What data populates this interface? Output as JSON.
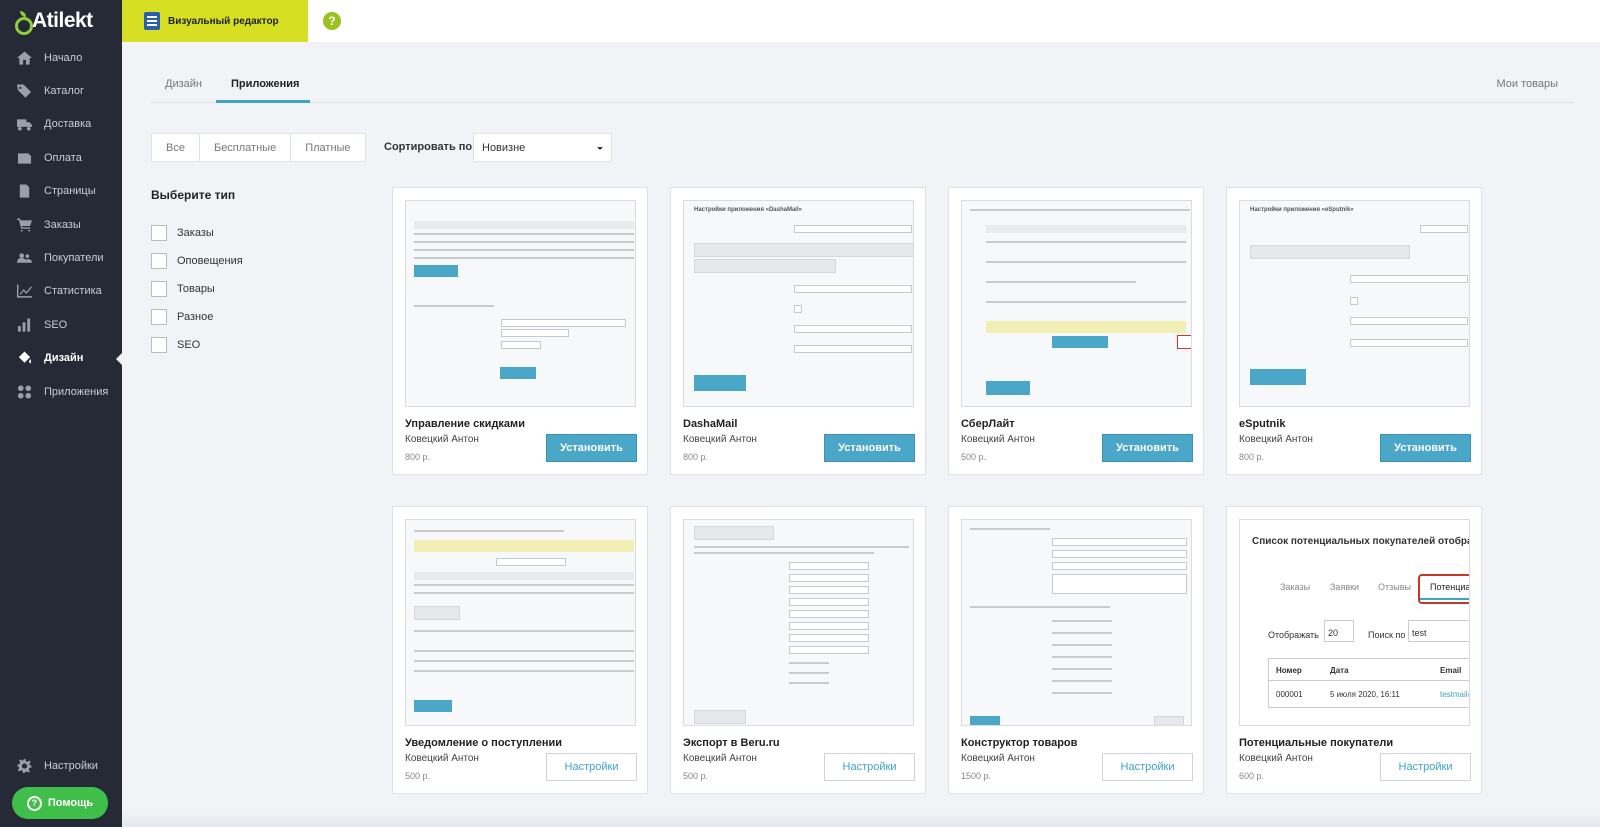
{
  "brand": {
    "name": "Atilekt",
    "accent": "#8fcf3c"
  },
  "sidebar": {
    "items": [
      {
        "label": "Начало",
        "icon": "home-icon"
      },
      {
        "label": "Каталог",
        "icon": "tag-icon"
      },
      {
        "label": "Доставка",
        "icon": "truck-icon"
      },
      {
        "label": "Оплата",
        "icon": "wallet-icon"
      },
      {
        "label": "Страницы",
        "icon": "page-icon"
      },
      {
        "label": "Заказы",
        "icon": "cart-icon"
      },
      {
        "label": "Покупатели",
        "icon": "users-icon"
      },
      {
        "label": "Статистика",
        "icon": "chart-line-icon"
      },
      {
        "label": "SEO",
        "icon": "bars-icon"
      },
      {
        "label": "Дизайн",
        "icon": "paint-icon"
      },
      {
        "label": "Приложения",
        "icon": "apps-icon"
      }
    ],
    "active": "Дизайн",
    "settings_label": "Настройки",
    "help_label": "Помощь"
  },
  "topbar": {
    "visual_editor_label": "Визуальный редактор",
    "help_symbol": "?"
  },
  "tabs": {
    "design": "Дизайн",
    "apps": "Приложения",
    "my_goods": "Мои товары"
  },
  "filters": {
    "price": [
      "Все",
      "Бесплатные",
      "Платные"
    ],
    "sort_label": "Сортировать по",
    "sort_value": "Новизне"
  },
  "types": {
    "title": "Выберите тип",
    "items": [
      "Заказы",
      "Оповещения",
      "Товары",
      "Разное",
      "SEO"
    ]
  },
  "apps": [
    {
      "title": "Управление скидками",
      "author": "Ковецкий Антон",
      "price": "800 р.",
      "action": "Установить"
    },
    {
      "title": "DashaMail",
      "author": "Ковецкий Антон",
      "price": "800 р.",
      "action": "Установить"
    },
    {
      "title": "СберЛайт",
      "author": "Ковецкий Антон",
      "price": "500 р.",
      "action": "Установить"
    },
    {
      "title": "eSputnik",
      "author": "Ковецкий Антон",
      "price": "800 р.",
      "action": "Установить"
    },
    {
      "title": "Уведомление о поступлении",
      "author": "Ковецкий Антон",
      "price": "500 р.",
      "action": "Настройки"
    },
    {
      "title": "Экспорт в Beru.ru",
      "author": "Ковецкий Антон",
      "price": "500 р.",
      "action": "Настройки"
    },
    {
      "title": "Конструктор товаров",
      "author": "Ковецкий Антон",
      "price": "1500 р.",
      "action": "Настройки"
    },
    {
      "title": "Потенциальные покупатели",
      "author": "Ковецкий Антон",
      "price": "600 р.",
      "action": "Настройки"
    }
  ],
  "thumb_texts": {
    "dashamail_title": "Настройки приложения «DashaMail»",
    "esputnik_title": "Настройки приложения «eSputnik»",
    "potential_title": "Список потенциальных покупателей отображ",
    "potential_tabs": [
      "Заказы",
      "Заявки",
      "Отзывы",
      "Потенциа"
    ],
    "potential_show": "Отображать",
    "potential_count": "20",
    "potential_search": "Поиск по",
    "potential_search_value": "test",
    "potential_cols": [
      "Номер",
      "Дата",
      "Email"
    ],
    "potential_row": [
      "000001",
      "5 июля 2020, 16:11",
      "testmail@"
    ]
  }
}
